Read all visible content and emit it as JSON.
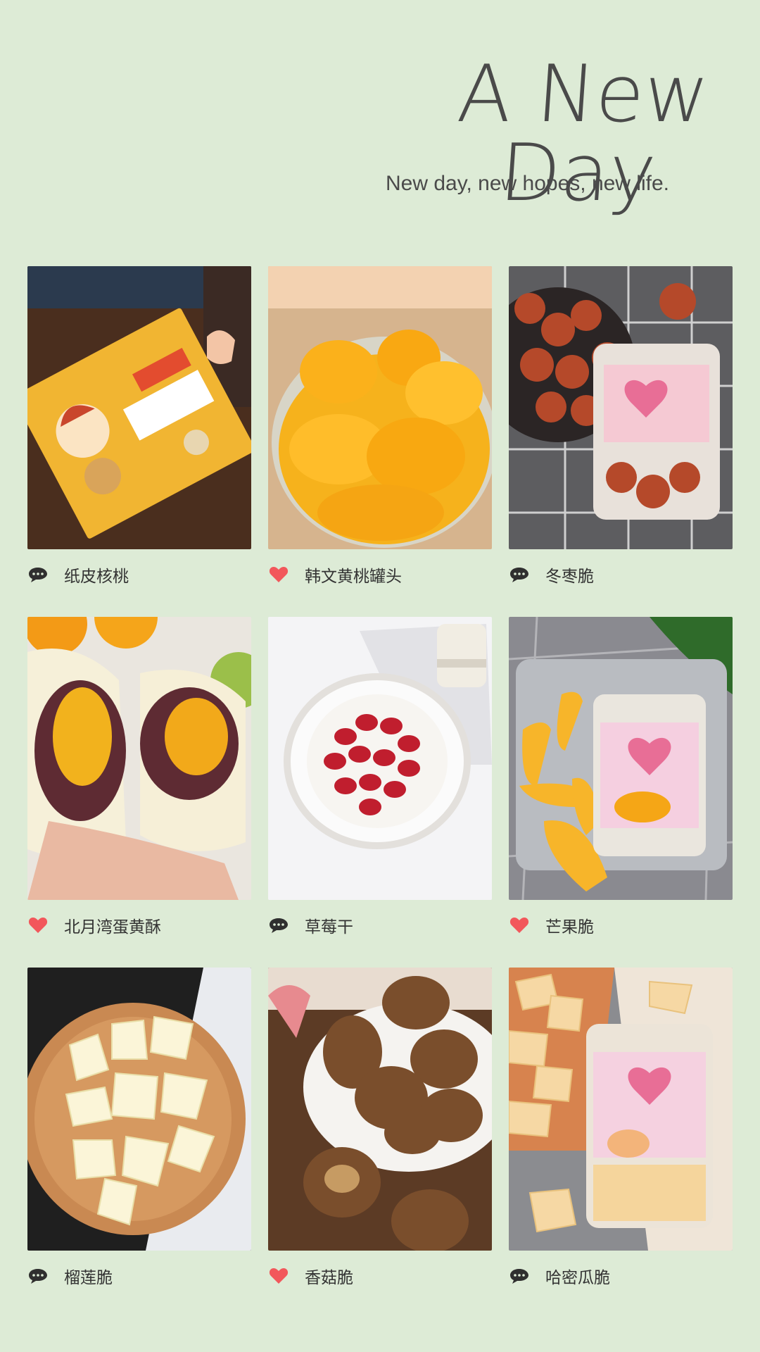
{
  "header": {
    "title": "A New Day",
    "subtitle": "New day, new hopes, new life."
  },
  "products": [
    {
      "label": "纸皮核桃",
      "icon": "comment-icon"
    },
    {
      "label": "韩文黄桃罐头",
      "icon": "heart-icon"
    },
    {
      "label": "冬枣脆",
      "icon": "comment-icon"
    },
    {
      "label": "北月湾蛋黄酥",
      "icon": "heart-icon"
    },
    {
      "label": "草莓干",
      "icon": "comment-icon"
    },
    {
      "label": "芒果脆",
      "icon": "heart-icon"
    },
    {
      "label": "榴莲脆",
      "icon": "comment-icon"
    },
    {
      "label": "香菇脆",
      "icon": "heart-icon"
    },
    {
      "label": "哈密瓜脆",
      "icon": "comment-icon"
    }
  ],
  "colors": {
    "background": "#ddebd6",
    "heart": "#f2575b",
    "comment": "#2f2f2f"
  }
}
